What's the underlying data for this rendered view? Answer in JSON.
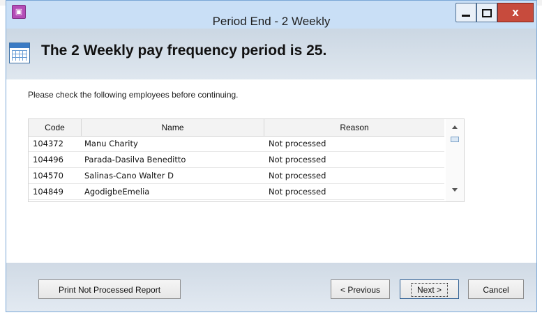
{
  "window": {
    "title": "Period End - 2 Weekly",
    "controls": {
      "minimize": "minimize",
      "maximize": "maximize",
      "close": "x"
    }
  },
  "header": {
    "headline": "The 2 Weekly pay frequency period is 25."
  },
  "instruction": "Please check the following employees before continuing.",
  "grid": {
    "columns": [
      "Code",
      "Name",
      "Reason"
    ],
    "rows": [
      {
        "code": "104372",
        "name": "Manu Charity",
        "reason": "Not processed"
      },
      {
        "code": "104496",
        "name": "Parada-Dasilva Beneditto",
        "reason": "Not processed"
      },
      {
        "code": "104570",
        "name": "Salinas-Cano Walter D",
        "reason": "Not processed"
      },
      {
        "code": "104849",
        "name": "AgodigbeEmelia",
        "reason": "Not processed"
      }
    ]
  },
  "footer": {
    "print_label": "Print Not Processed Report",
    "previous_label": "< Previous",
    "next_label": "Next >",
    "cancel_label": "Cancel"
  },
  "icons": {
    "app": "app-icon",
    "calendar": "calendar-icon",
    "scroll_up": "scroll-up-arrow-icon",
    "scroll_down": "scroll-down-arrow-icon"
  },
  "colors": {
    "titlebar": "#c9dff6",
    "close_button": "#c74b3d",
    "header_band": "#cbd7e3",
    "footer_band": "#d0dae5"
  }
}
